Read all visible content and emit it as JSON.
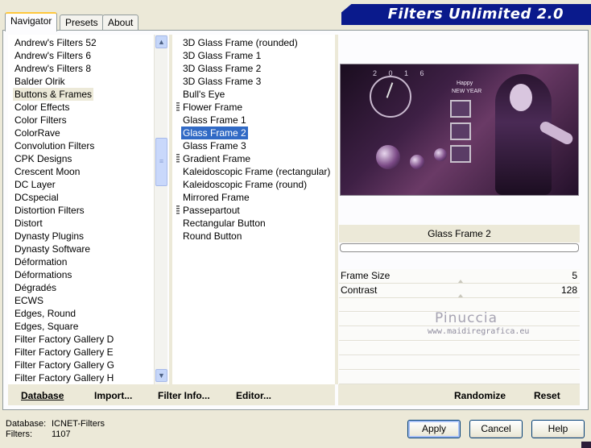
{
  "tabs": [
    {
      "label": "Navigator",
      "active": true
    },
    {
      "label": "Presets",
      "active": false
    },
    {
      "label": "About",
      "active": false
    }
  ],
  "banner_title": "Filters Unlimited 2.0",
  "categories": [
    "Andrew's Filters 52",
    "Andrew's Filters 6",
    "Andrew's Filters 8",
    "Balder Olrik",
    "Buttons & Frames",
    "Color Effects",
    "Color Filters",
    "ColorRave",
    "Convolution Filters",
    "CPK Designs",
    "Crescent Moon",
    "DC Layer",
    "DCspecial",
    "Distortion Filters",
    "Distort",
    "Dynasty Plugins",
    "Dynasty Software",
    "Déformation",
    "Déformations",
    "Dégradés",
    "ECWS",
    "Edges, Round",
    "Edges, Square",
    "Filter Factory Gallery D",
    "Filter Factory Gallery E",
    "Filter Factory Gallery G",
    "Filter Factory Gallery H"
  ],
  "selected_category": "Buttons & Frames",
  "filters": [
    {
      "label": "3D Glass Frame (rounded)",
      "marked": false
    },
    {
      "label": "3D Glass Frame 1",
      "marked": false
    },
    {
      "label": "3D Glass Frame 2",
      "marked": false
    },
    {
      "label": "3D Glass Frame 3",
      "marked": false
    },
    {
      "label": "Bull's Eye",
      "marked": false
    },
    {
      "label": "Flower Frame",
      "marked": true
    },
    {
      "label": "Glass Frame 1",
      "marked": false
    },
    {
      "label": "Glass Frame 2",
      "marked": false
    },
    {
      "label": "Glass Frame 3",
      "marked": false
    },
    {
      "label": "Gradient Frame",
      "marked": true
    },
    {
      "label": "Kaleidoscopic Frame (rectangular)",
      "marked": false
    },
    {
      "label": "Kaleidoscopic Frame (round)",
      "marked": false
    },
    {
      "label": "Mirrored Frame",
      "marked": false
    },
    {
      "label": "Passepartout",
      "marked": true
    },
    {
      "label": "Rectangular Button",
      "marked": false
    },
    {
      "label": "Round Button",
      "marked": false
    }
  ],
  "selected_filter": "Glass Frame 2",
  "preview": {
    "year_digits": "2 0 1 6",
    "label_happy": "Happy",
    "label_new_year": "NEW YEAR"
  },
  "filter_name": "Glass Frame 2",
  "progress_fraction": 0.0,
  "params": [
    {
      "label": "Frame Size",
      "value": "5"
    },
    {
      "label": "Contrast",
      "value": "128"
    }
  ],
  "watermark": {
    "name": "Pinuccia",
    "url": "www.maidiregrafica.eu"
  },
  "bottom_links": {
    "database": "Database",
    "import": "Import...",
    "filter_info": "Filter Info...",
    "editor": "Editor...",
    "randomize": "Randomize",
    "reset": "Reset"
  },
  "status": {
    "database_label": "Database:",
    "database_value": "ICNET-Filters",
    "filters_label": "Filters:",
    "filters_value": "1107"
  },
  "buttons": {
    "apply": "Apply",
    "cancel": "Cancel",
    "help": "Help"
  },
  "colors": {
    "banner": "#0a1a8c",
    "selection": "#316ac5",
    "tab_highlight": "#ffc83c"
  }
}
